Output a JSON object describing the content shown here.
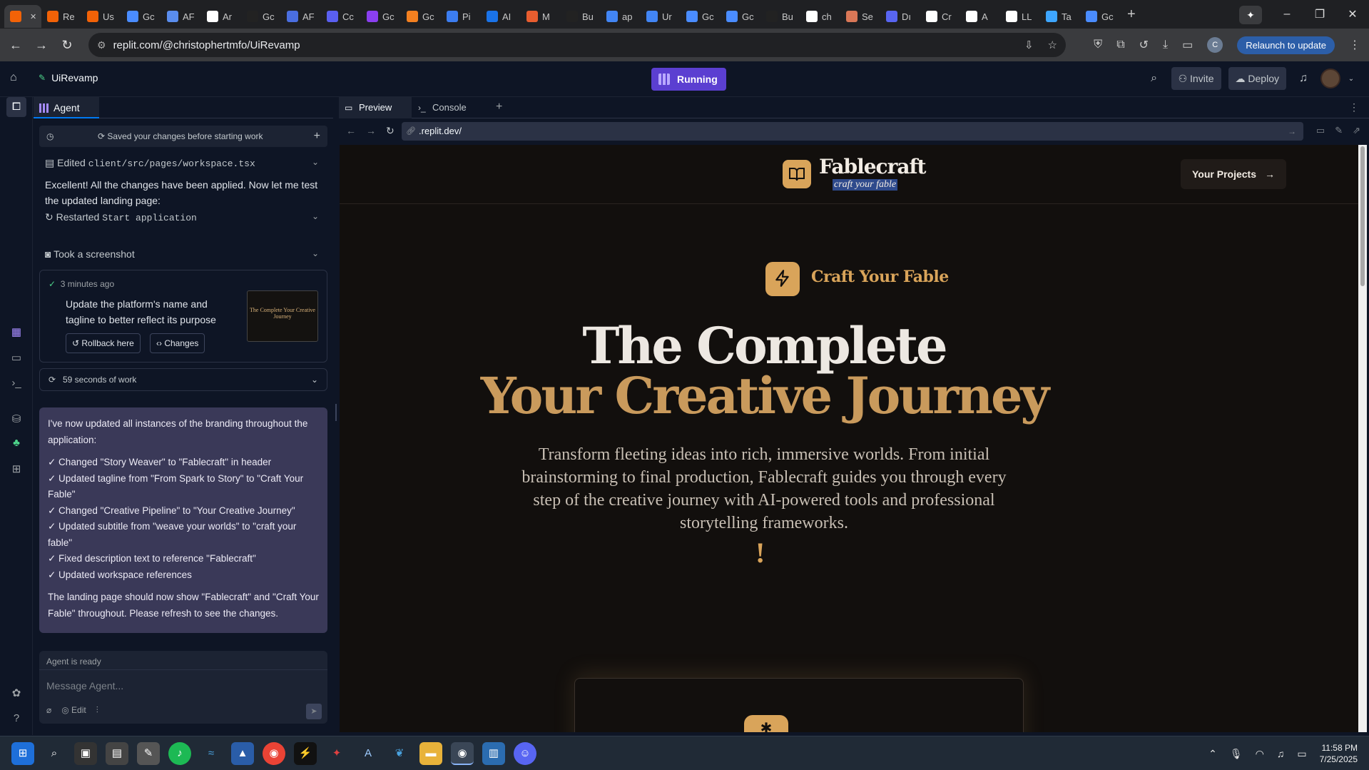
{
  "browser": {
    "tabs": [
      {
        "label": "",
        "color": "#f26207",
        "active": true
      },
      {
        "label": "Re",
        "color": "#f26207"
      },
      {
        "label": "Us",
        "color": "#f26207"
      },
      {
        "label": "Gc",
        "color": "#4a8cff"
      },
      {
        "label": "AF",
        "color": "#5a8dee"
      },
      {
        "label": "Ar",
        "color": "#ffffff"
      },
      {
        "label": "Gc",
        "color": "#222222"
      },
      {
        "label": "AF",
        "color": "#4a6ee0"
      },
      {
        "label": "Cc",
        "color": "#5a5ff0"
      },
      {
        "label": "Gc",
        "color": "#8a3ff0"
      },
      {
        "label": "Gc",
        "color": "#f38020"
      },
      {
        "label": "Pi",
        "color": "#3c7df0"
      },
      {
        "label": "AI",
        "color": "#1a73e8"
      },
      {
        "label": "M",
        "color": "#e85d2f"
      },
      {
        "label": "Bu",
        "color": "#222222"
      },
      {
        "label": "ap",
        "color": "#4285f4"
      },
      {
        "label": "Ur",
        "color": "#4285f4"
      },
      {
        "label": "Gc",
        "color": "#4a8cff"
      },
      {
        "label": "Gc",
        "color": "#4a8cff"
      },
      {
        "label": "Bu",
        "color": "#222222"
      },
      {
        "label": "ch",
        "color": "#ffffff"
      },
      {
        "label": "Se",
        "color": "#d97757"
      },
      {
        "label": "Dı",
        "color": "#5865f2"
      },
      {
        "label": "Cr",
        "color": "#ffffff"
      },
      {
        "label": "A",
        "color": "#ffffff"
      },
      {
        "label": "LL",
        "color": "#ffffff"
      },
      {
        "label": "Ta",
        "color": "#3ea6ff"
      },
      {
        "label": "Gc",
        "color": "#4a8cff"
      }
    ],
    "url": "replit.com/@christophertmfo/UiRevamp",
    "relaunch_label": "Relaunch to update",
    "profile_initial": "C"
  },
  "replit": {
    "project_name": "UiRevamp",
    "run_status": "Running",
    "invite_label": "Invite",
    "deploy_label": "Deploy"
  },
  "agent": {
    "tab_label": "Agent",
    "saved_notice": "Saved your changes before starting work",
    "edited_prefix": "Edited",
    "edited_file": "client/src/pages/workspace.tsx",
    "intro_text": "Excellent! All the changes have been applied. Now let me test the updated landing page:",
    "restarted_prefix": "Restarted",
    "restarted_target": "Start application",
    "screenshot_label": "Took a screenshot",
    "checkpoint": {
      "time": "3 minutes ago",
      "message": "Update the platform's name and tagline to better reflect its purpose",
      "rollback_label": "Rollback here",
      "changes_label": "Changes",
      "thumb_text": "The Complete Your Creative Journey"
    },
    "work_label": "59 seconds of work",
    "reply": {
      "intro": "I've now updated all instances of the branding throughout the application:",
      "items": [
        "✓ Changed \"Story Weaver\" to \"Fablecraft\" in header",
        "✓ Updated tagline from \"From Spark to Story\" to \"Craft Your Fable\"",
        "✓ Changed \"Creative Pipeline\" to \"Your Creative Journey\"",
        "✓ Updated subtitle from \"weave your worlds\" to \"craft your fable\"",
        "✓ Fixed description text to reference \"Fablecraft\"",
        "✓ Updated workspace references"
      ],
      "outro": "The landing page should now show \"Fablecraft\" and \"Craft Your Fable\" throughout. Please refresh to see the changes."
    },
    "composer": {
      "status": "Agent is ready",
      "placeholder": "Message Agent...",
      "edit_label": "Edit"
    }
  },
  "preview": {
    "tabs": {
      "preview": "Preview",
      "console": "Console"
    },
    "url": ".replit.dev/",
    "site": {
      "brand": "Fablecraft",
      "tagline": "craft your fable",
      "projects_button": "Your Projects",
      "badge": "Craft Your Fable",
      "headline_1": "The Complete",
      "headline_2": "Your Creative Journey",
      "lead": "Transform fleeting ideas into rich, immersive worlds. From initial brainstorming to final production, Fablecraft guides you through every step of the creative journey with AI-powered tools and professional storytelling frameworks.",
      "exclaim": "!"
    }
  },
  "taskbar": {
    "time": "11:58 PM",
    "date": "7/25/2025"
  },
  "colors": {
    "accent_gold": "#c99a5c",
    "running_purple": "#5b3fd1",
    "message_bubble": "#3a3958",
    "relaunch_blue": "#2c5ea8"
  }
}
